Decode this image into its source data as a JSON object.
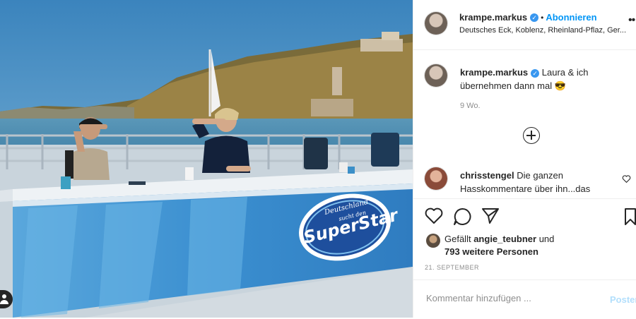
{
  "post": {
    "author": "krampe.markus",
    "follow_label": "Abonnieren",
    "separator": "•",
    "location": "Deutsches Eck, Koblenz, Rheinland-Pflaz, Ger...",
    "more_icon": "more-horizontal-icon",
    "verified_icon": "verified-badge-icon"
  },
  "media": {
    "logo_line1": "Deutschland",
    "logo_line2": "sucht den",
    "logo_line3": "SuperStar"
  },
  "caption": {
    "author": "krampe.markus",
    "text": "Laura & ich übernehmen dann mal 😎",
    "time": "9 Wo."
  },
  "comments": [
    {
      "author": "chrisstengel",
      "text": "Die ganzen Hasskommentare über ihn...das"
    }
  ],
  "actions": {
    "like_icon": "heart-icon",
    "comment_icon": "comment-icon",
    "share_icon": "share-icon",
    "save_icon": "bookmark-icon"
  },
  "likes": {
    "prefix": "Gefällt",
    "user": "angie_teubner",
    "conjunction": "und",
    "others": "793 weitere Personen"
  },
  "date": "21. SEPTEMBER",
  "comment_input": {
    "placeholder": "Kommentar hinzufügen ...",
    "post_label": "Posten"
  },
  "colors": {
    "accent": "#0095f6",
    "verified": "#3897f0",
    "post_disabled": "#b2dffc"
  }
}
